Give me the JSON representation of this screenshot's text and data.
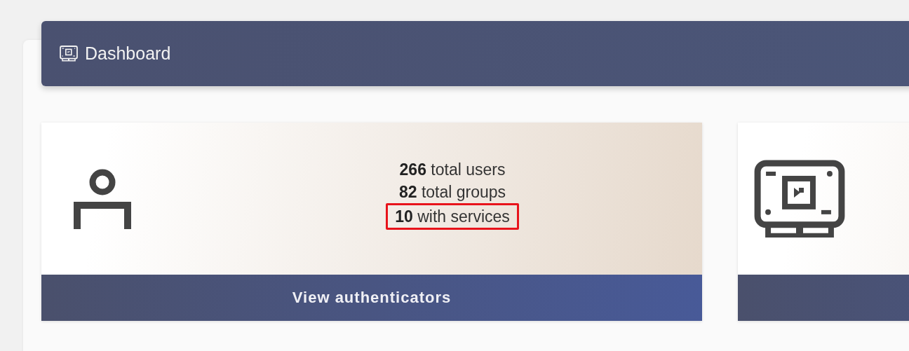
{
  "header": {
    "title": "Dashboard"
  },
  "cards": [
    {
      "kind": "users",
      "stats": [
        {
          "text": "**266** total users",
          "highlighted": false
        },
        {
          "text": "**82** total groups",
          "highlighted": false
        },
        {
          "text": "**10** with services",
          "highlighted": true
        }
      ],
      "button": "View authenticators"
    },
    {
      "kind": "services"
    }
  ]
}
